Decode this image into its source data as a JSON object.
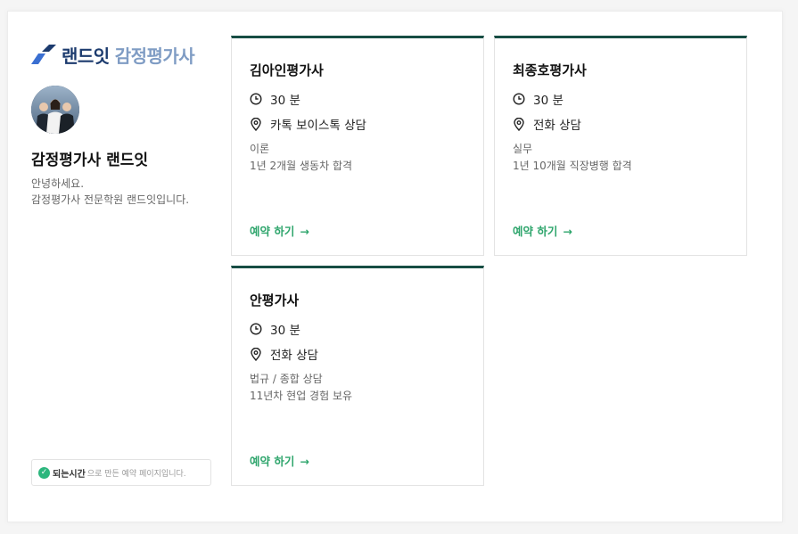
{
  "profile": {
    "logo_main": "랜드잇",
    "logo_sub": "감정평가사",
    "name": "감정평가사 랜드잇",
    "greeting": "안녕하세요.",
    "description": "감정평가사 전문학원 랜드잇입니다."
  },
  "badge": {
    "brand": "되는시간",
    "text": "으로 만든 예약 페이지입니다."
  },
  "cards": [
    {
      "name": "김아인평가사",
      "duration": "30 분",
      "method": "카톡 보이스톡 상담",
      "category": "이론",
      "experience": "1년 2개월 생동차 합격",
      "book_label": "예약 하기",
      "arrow": "→"
    },
    {
      "name": "최종호평가사",
      "duration": "30 분",
      "method": "전화 상담",
      "category": "실무",
      "experience": "1년 10개월 직장병행 합격",
      "book_label": "예약 하기",
      "arrow": "→"
    },
    {
      "name": "안평가사",
      "duration": "30 분",
      "method": "전화 상담",
      "category": "법규 / 종합 상담",
      "experience": "11년차 현업 경험 보유",
      "book_label": "예약 하기",
      "arrow": "→"
    }
  ],
  "colors": {
    "accent_green": "#2ea56c",
    "card_top_border": "#174d44",
    "logo_navy": "#1c3b6e",
    "logo_light": "#7f9cc4"
  },
  "icons": {
    "clock": "clock-icon",
    "location": "location-pin-icon",
    "check": "check-circle-icon",
    "arrow": "arrow-right-icon"
  }
}
